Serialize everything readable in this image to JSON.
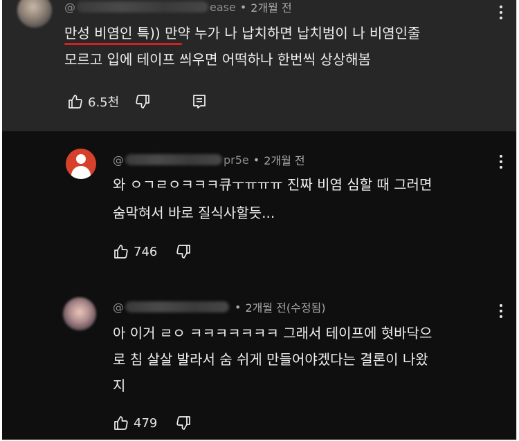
{
  "comments": [
    {
      "handle_prefix": "@",
      "handle_suffix": "ease",
      "time": "2개월 전",
      "line1_highlight": "만성 비염인 특",
      "line1_rest": ")) 만약 누가 나 납치하면 납치범이 나 비염인줄",
      "line2": "모르고 입에 테이프 씌우면 어떡하나 한번씩 상상해봄",
      "likes": "6.5천",
      "highlight_color": "#d62020"
    },
    {
      "handle_prefix": "@",
      "handle_suffix": "pr5e",
      "time": "2개월 전",
      "line1": "와 ㅇㄱㄹㅇㅋㅋㅋ큐ㅜㅠㅠㅠ 진짜 비염 심할 때 그러면",
      "line2": "숨막혀서 바로 질식사할듯...",
      "likes": "746",
      "avatar_color": "#d7412c"
    },
    {
      "handle_prefix": "@",
      "time": "2개월 전(수정됨)",
      "line1": "아 이거 ㄹㅇ ㅋㅋㅋㅋㅋㅋㅋ 그래서 테이프에 혓바닥으",
      "line2": "로 침 살살 발라서 숨 쉬게 만들어야겠다는 결론이 나왔",
      "line3": "지",
      "likes": "479"
    }
  ],
  "icons": {
    "like": "thumbs-up-icon",
    "dislike": "thumbs-down-icon",
    "reply": "reply-icon",
    "more": "more-vertical-icon"
  }
}
